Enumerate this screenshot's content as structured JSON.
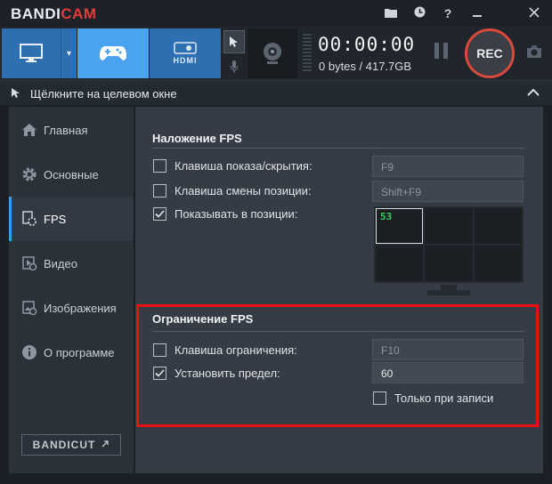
{
  "app": {
    "logo_part1": "BANDI",
    "logo_part2": "CAM"
  },
  "titlebar_icons": [
    "folder-icon",
    "clock-icon",
    "help-icon",
    "minimize-icon",
    "close-icon"
  ],
  "toolbar": {
    "hdmi_label": "HDMI",
    "timer": "00:00:00",
    "size": "0 bytes / 417.7GB",
    "rec_label": "REC"
  },
  "target": {
    "text": "Щёлкните на целевом окне"
  },
  "sidebar": {
    "items": [
      {
        "label": "Главная",
        "icon": "home-icon"
      },
      {
        "label": "Основные",
        "icon": "gear-icon"
      },
      {
        "label": "FPS",
        "icon": "fps-gear-icon",
        "active": true
      },
      {
        "label": "Видео",
        "icon": "video-icon"
      },
      {
        "label": "Изображения",
        "icon": "image-icon"
      },
      {
        "label": "О программе",
        "icon": "info-icon"
      }
    ],
    "bandicut_label": "BANDICUT"
  },
  "fps_overlay": {
    "title": "Наложение FPS",
    "show_hide_key": {
      "label": "Клавиша показа/скрытия:",
      "checked": false,
      "value": "F9"
    },
    "position_key": {
      "label": "Клавиша смены позиции:",
      "checked": false,
      "value": "Shift+F9"
    },
    "show_in_position": {
      "label": "Показывать в позиции:",
      "checked": true
    },
    "fps_sample": "53"
  },
  "fps_limit": {
    "title": "Ограничение FPS",
    "limit_key": {
      "label": "Клавиша ограничения:",
      "checked": false,
      "value": "F10"
    },
    "set_limit": {
      "label": "Установить предел:",
      "checked": true,
      "value": "60"
    },
    "only_recording": {
      "label": "Только при записи",
      "checked": false
    }
  },
  "colors": {
    "accent": "#3f9be6",
    "rec_ring": "#d9493c",
    "highlight": "#e81010",
    "fps_green": "#34d058"
  }
}
